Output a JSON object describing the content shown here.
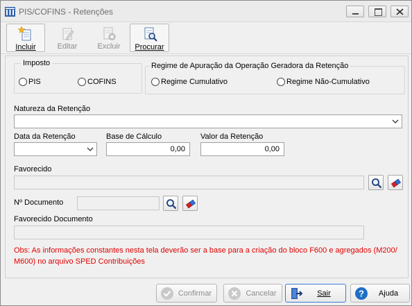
{
  "window": {
    "title": "PIS/COFINS - Retenções",
    "controls": [
      "minimize-icon",
      "maximize-icon",
      "close-icon"
    ]
  },
  "toolbar": {
    "incluir": {
      "label": "Incluir",
      "icon": "new-document-star-icon",
      "enabled": true
    },
    "editar": {
      "label": "Editar",
      "icon": "edit-document-icon",
      "enabled": false
    },
    "excluir": {
      "label": "Excluir",
      "icon": "delete-document-icon",
      "enabled": false
    },
    "procurar": {
      "label": "Procurar",
      "icon": "search-document-icon",
      "enabled": true
    }
  },
  "form": {
    "imposto": {
      "title": "Imposto",
      "options": [
        "PIS",
        "COFINS"
      ],
      "selected": null
    },
    "regime": {
      "title": "Regime de Apuração da Operação Geradora da Retenção",
      "options": [
        "Regime Cumulativo",
        "Regime Não-Cumulativo"
      ],
      "selected": null
    },
    "natureza": {
      "label": "Natureza da Retenção",
      "value": ""
    },
    "data": {
      "label": "Data da Retenção",
      "value": ""
    },
    "base": {
      "label": "Base de Cálculo",
      "value": "0,00"
    },
    "valor": {
      "label": "Valor da Retenção",
      "value": "0,00"
    },
    "favorecido": {
      "label": "Favorecido",
      "value": ""
    },
    "documento": {
      "label": "Nº Documento",
      "value": ""
    },
    "favorecido_documento": {
      "label": "Favorecido Documento",
      "value": ""
    },
    "obs": "Obs: As informações constantes nesta tela deverão ser a base para a criação do bloco F600 e agregados (M200/ M600) no arquivo SPED Contribuições"
  },
  "buttons": {
    "confirmar": {
      "label": "Confirmar",
      "icon": "check-circle-icon",
      "enabled": false
    },
    "cancelar": {
      "label": "Cancelar",
      "icon": "cancel-circle-icon",
      "enabled": false
    },
    "sair": {
      "label": "Sair",
      "icon": "exit-door-icon",
      "enabled": true
    },
    "ajuda": {
      "label": "Ajuda",
      "icon": "help-question-icon",
      "enabled": true
    }
  },
  "colors": {
    "obs_text": "#e00000",
    "help_icon": "#1f6fc5",
    "focus_border": "#3a7bd5"
  }
}
